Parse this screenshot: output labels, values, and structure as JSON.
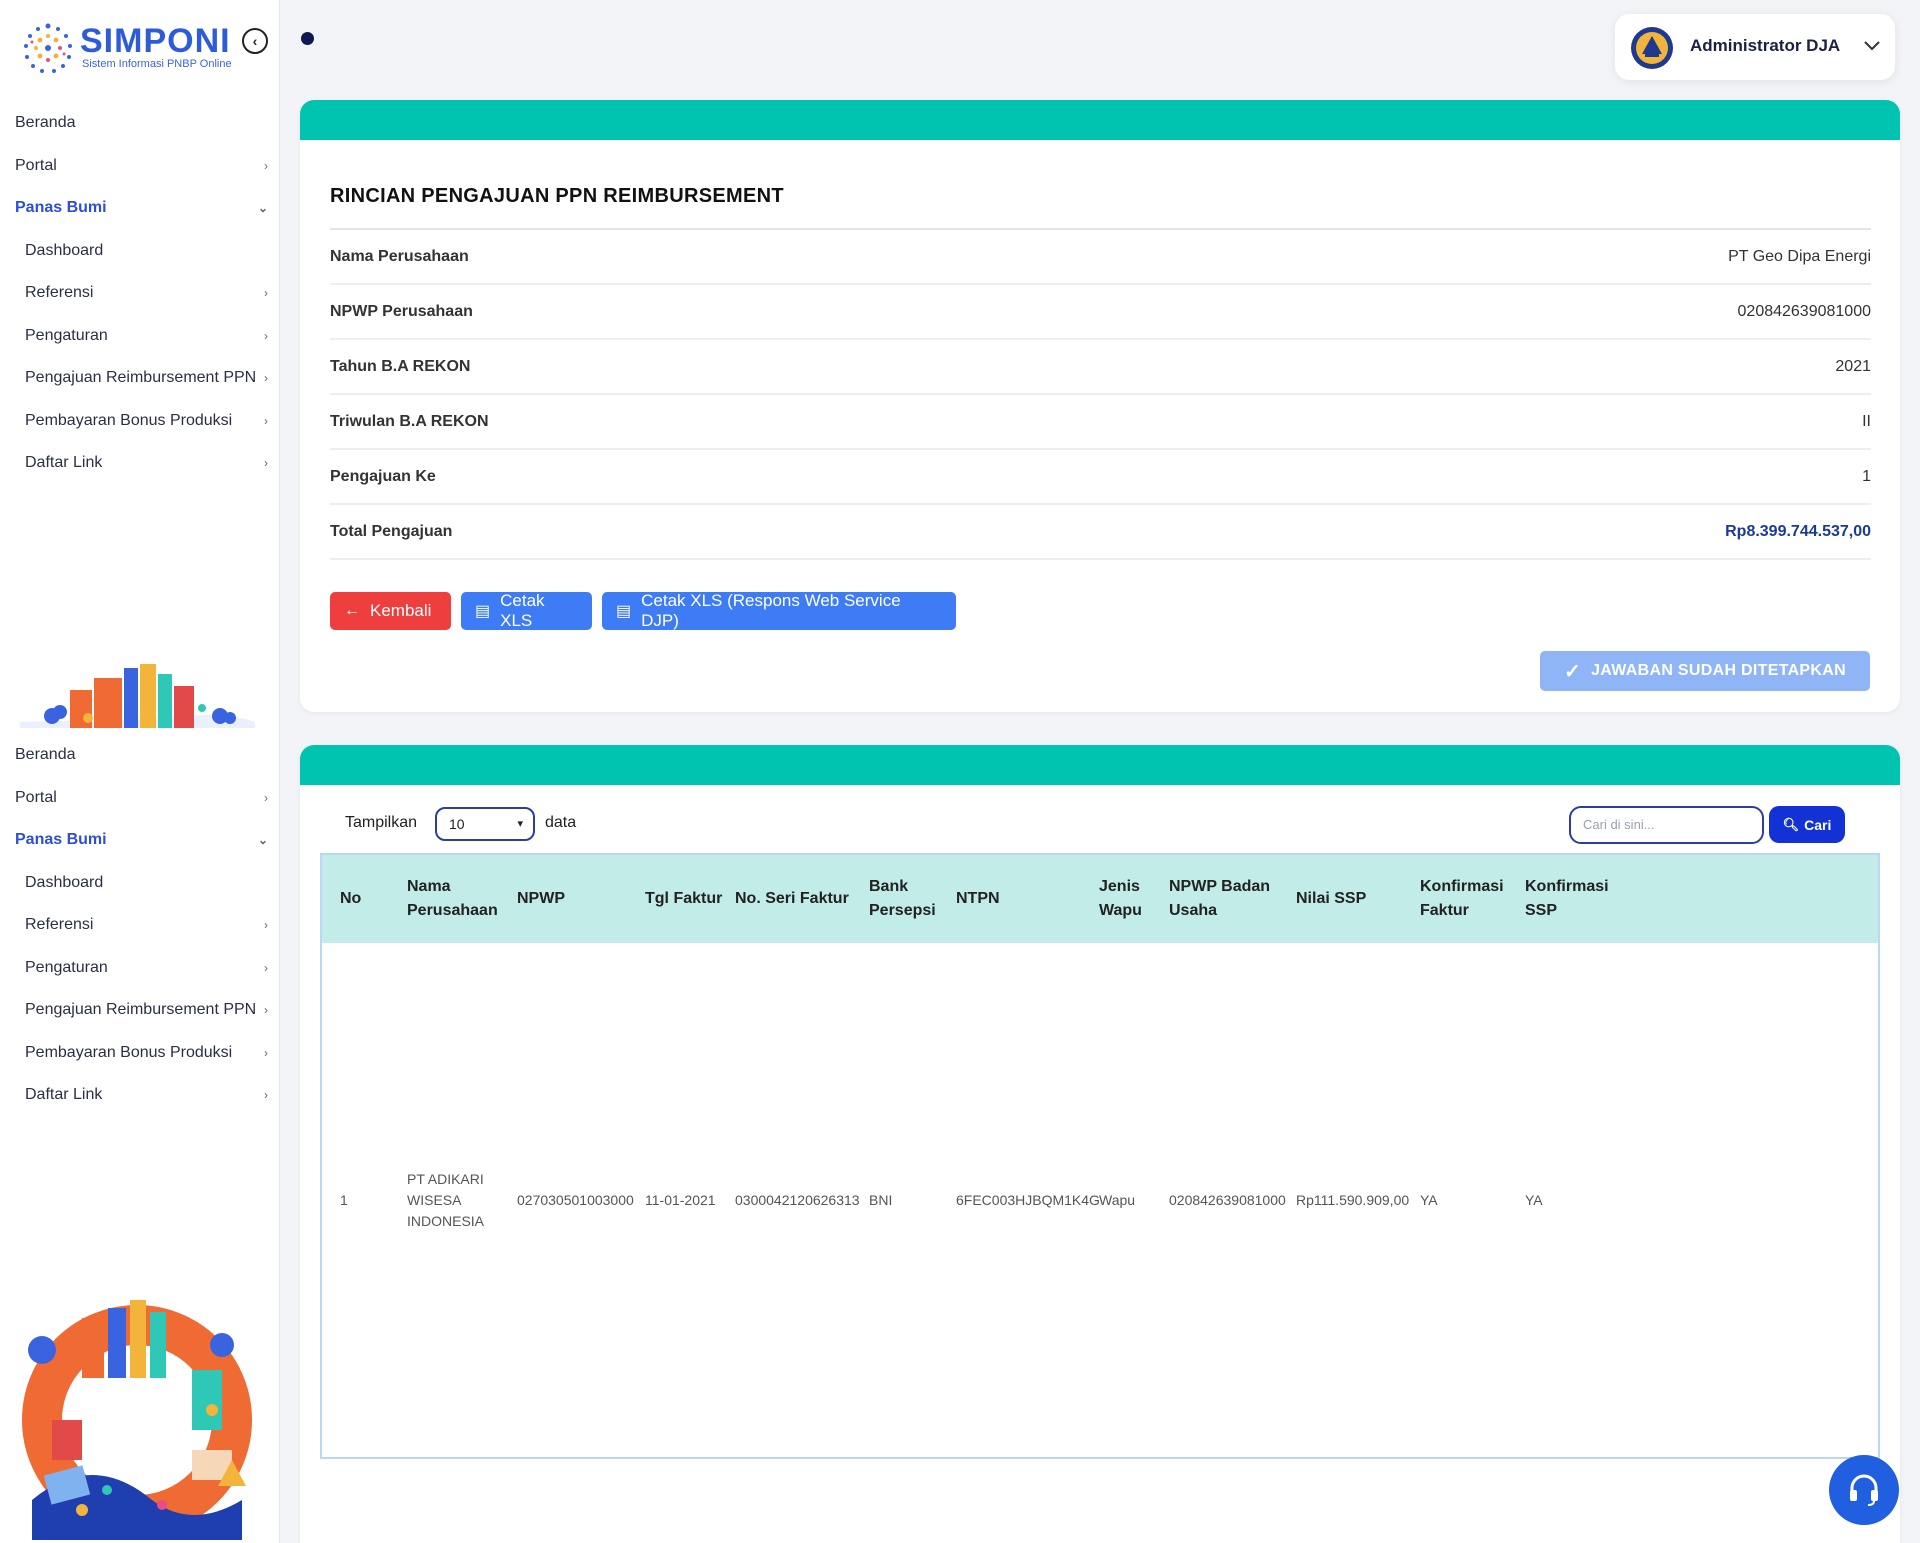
{
  "app": {
    "logo_title": "SIMPONI",
    "logo_subtitle": "Sistem Informasi PNBP Online"
  },
  "sidebar": {
    "menu1": [
      {
        "label": "Beranda",
        "chevron": ""
      },
      {
        "label": "Portal",
        "chevron": "›"
      },
      {
        "label": "Panas Bumi",
        "chevron": "⌄",
        "active": true
      },
      {
        "label": "Dashboard",
        "chevron": "",
        "sub": true
      },
      {
        "label": "Referensi",
        "chevron": "›",
        "sub": true
      },
      {
        "label": "Pengaturan",
        "chevron": "›",
        "sub": true
      },
      {
        "label": "Pengajuan Reimbursement PPN",
        "chevron": "›",
        "sub": true
      },
      {
        "label": "Pembayaran Bonus Produksi",
        "chevron": "›",
        "sub": true
      },
      {
        "label": "Daftar Link",
        "chevron": "›",
        "sub": true
      }
    ],
    "menu2": [
      {
        "label": "Beranda",
        "chevron": ""
      },
      {
        "label": "Portal",
        "chevron": "›"
      },
      {
        "label": "Panas Bumi",
        "chevron": "⌄",
        "active": true
      },
      {
        "label": "Dashboard",
        "chevron": "",
        "sub": true
      },
      {
        "label": "Referensi",
        "chevron": "›",
        "sub": true
      },
      {
        "label": "Pengaturan",
        "chevron": "›",
        "sub": true
      },
      {
        "label": "Pengajuan Reimbursement PPN",
        "chevron": "›",
        "sub": true
      },
      {
        "label": "Pembayaran Bonus Produksi",
        "chevron": "›",
        "sub": true
      },
      {
        "label": "Daftar Link",
        "chevron": "›",
        "sub": true
      }
    ]
  },
  "header": {
    "user_name": "Administrator DJA"
  },
  "detail": {
    "title": "RINCIAN PENGAJUAN PPN REIMBURSEMENT",
    "rows": [
      {
        "label": "Nama Perusahaan",
        "value": "PT Geo Dipa Energi"
      },
      {
        "label": "NPWP Perusahaan",
        "value": "020842639081000"
      },
      {
        "label": "Tahun B.A REKON",
        "value": "2021"
      },
      {
        "label": "Triwulan B.A REKON",
        "value": "II"
      },
      {
        "label": "Pengajuan Ke",
        "value": "1"
      },
      {
        "label": "Total Pengajuan",
        "value": "Rp8.399.744.537,00"
      }
    ],
    "buttons": {
      "back": "Kembali",
      "xls": "Cetak XLS",
      "xls_djp": "Cetak XLS (Respons Web Service DJP)",
      "done": "JAWABAN SUDAH DITETAPKAN"
    }
  },
  "table": {
    "show_label": "Tampilkan",
    "page_size": "10",
    "data_label": "data",
    "search_placeholder": "Cari di sini...",
    "search_button": "Cari",
    "columns": [
      "No",
      "Nama Perusahaan",
      "NPWP",
      "Tgl Faktur",
      "No. Seri Faktur",
      "Bank Persepsi",
      "NTPN",
      "Jenis Wapu",
      "NPWP Badan Usaha",
      "Nilai SSP",
      "Konfirmasi Faktur",
      "Konfirmasi SSP"
    ],
    "rows": [
      [
        "1",
        "PT ADIKARI WISESA INDONESIA",
        "027030501003000",
        "11-01-2021",
        "0300042120626313",
        "BNI",
        "6FEC003HJBQM1K4G",
        "Wapu",
        "020842639081000",
        "Rp111.590.909,00",
        "YA",
        "YA"
      ]
    ]
  },
  "colors": {
    "accent_teal": "#00c4b0",
    "primary_blue": "#3d7cf5",
    "danger_red": "#ef3e3e",
    "header_bg": "#c1ece8"
  }
}
